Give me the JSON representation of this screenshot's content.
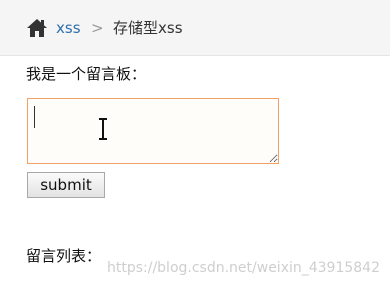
{
  "breadcrumb": {
    "home_icon": "home-icon",
    "link": "xss",
    "separator_icon": "chevron-right-icon",
    "separator": ">",
    "current": "存储型xss"
  },
  "form": {
    "label": "我是一个留言板：",
    "textarea_value": "",
    "textarea_placeholder": "",
    "submit_label": "submit"
  },
  "list": {
    "label": "留言列表："
  },
  "watermark": "https://blog.csdn.net/weixin_43915842",
  "colors": {
    "link": "#2f6fab",
    "focus_border": "#f0a266",
    "breadcrumb_bg": "#f5f5f5"
  }
}
